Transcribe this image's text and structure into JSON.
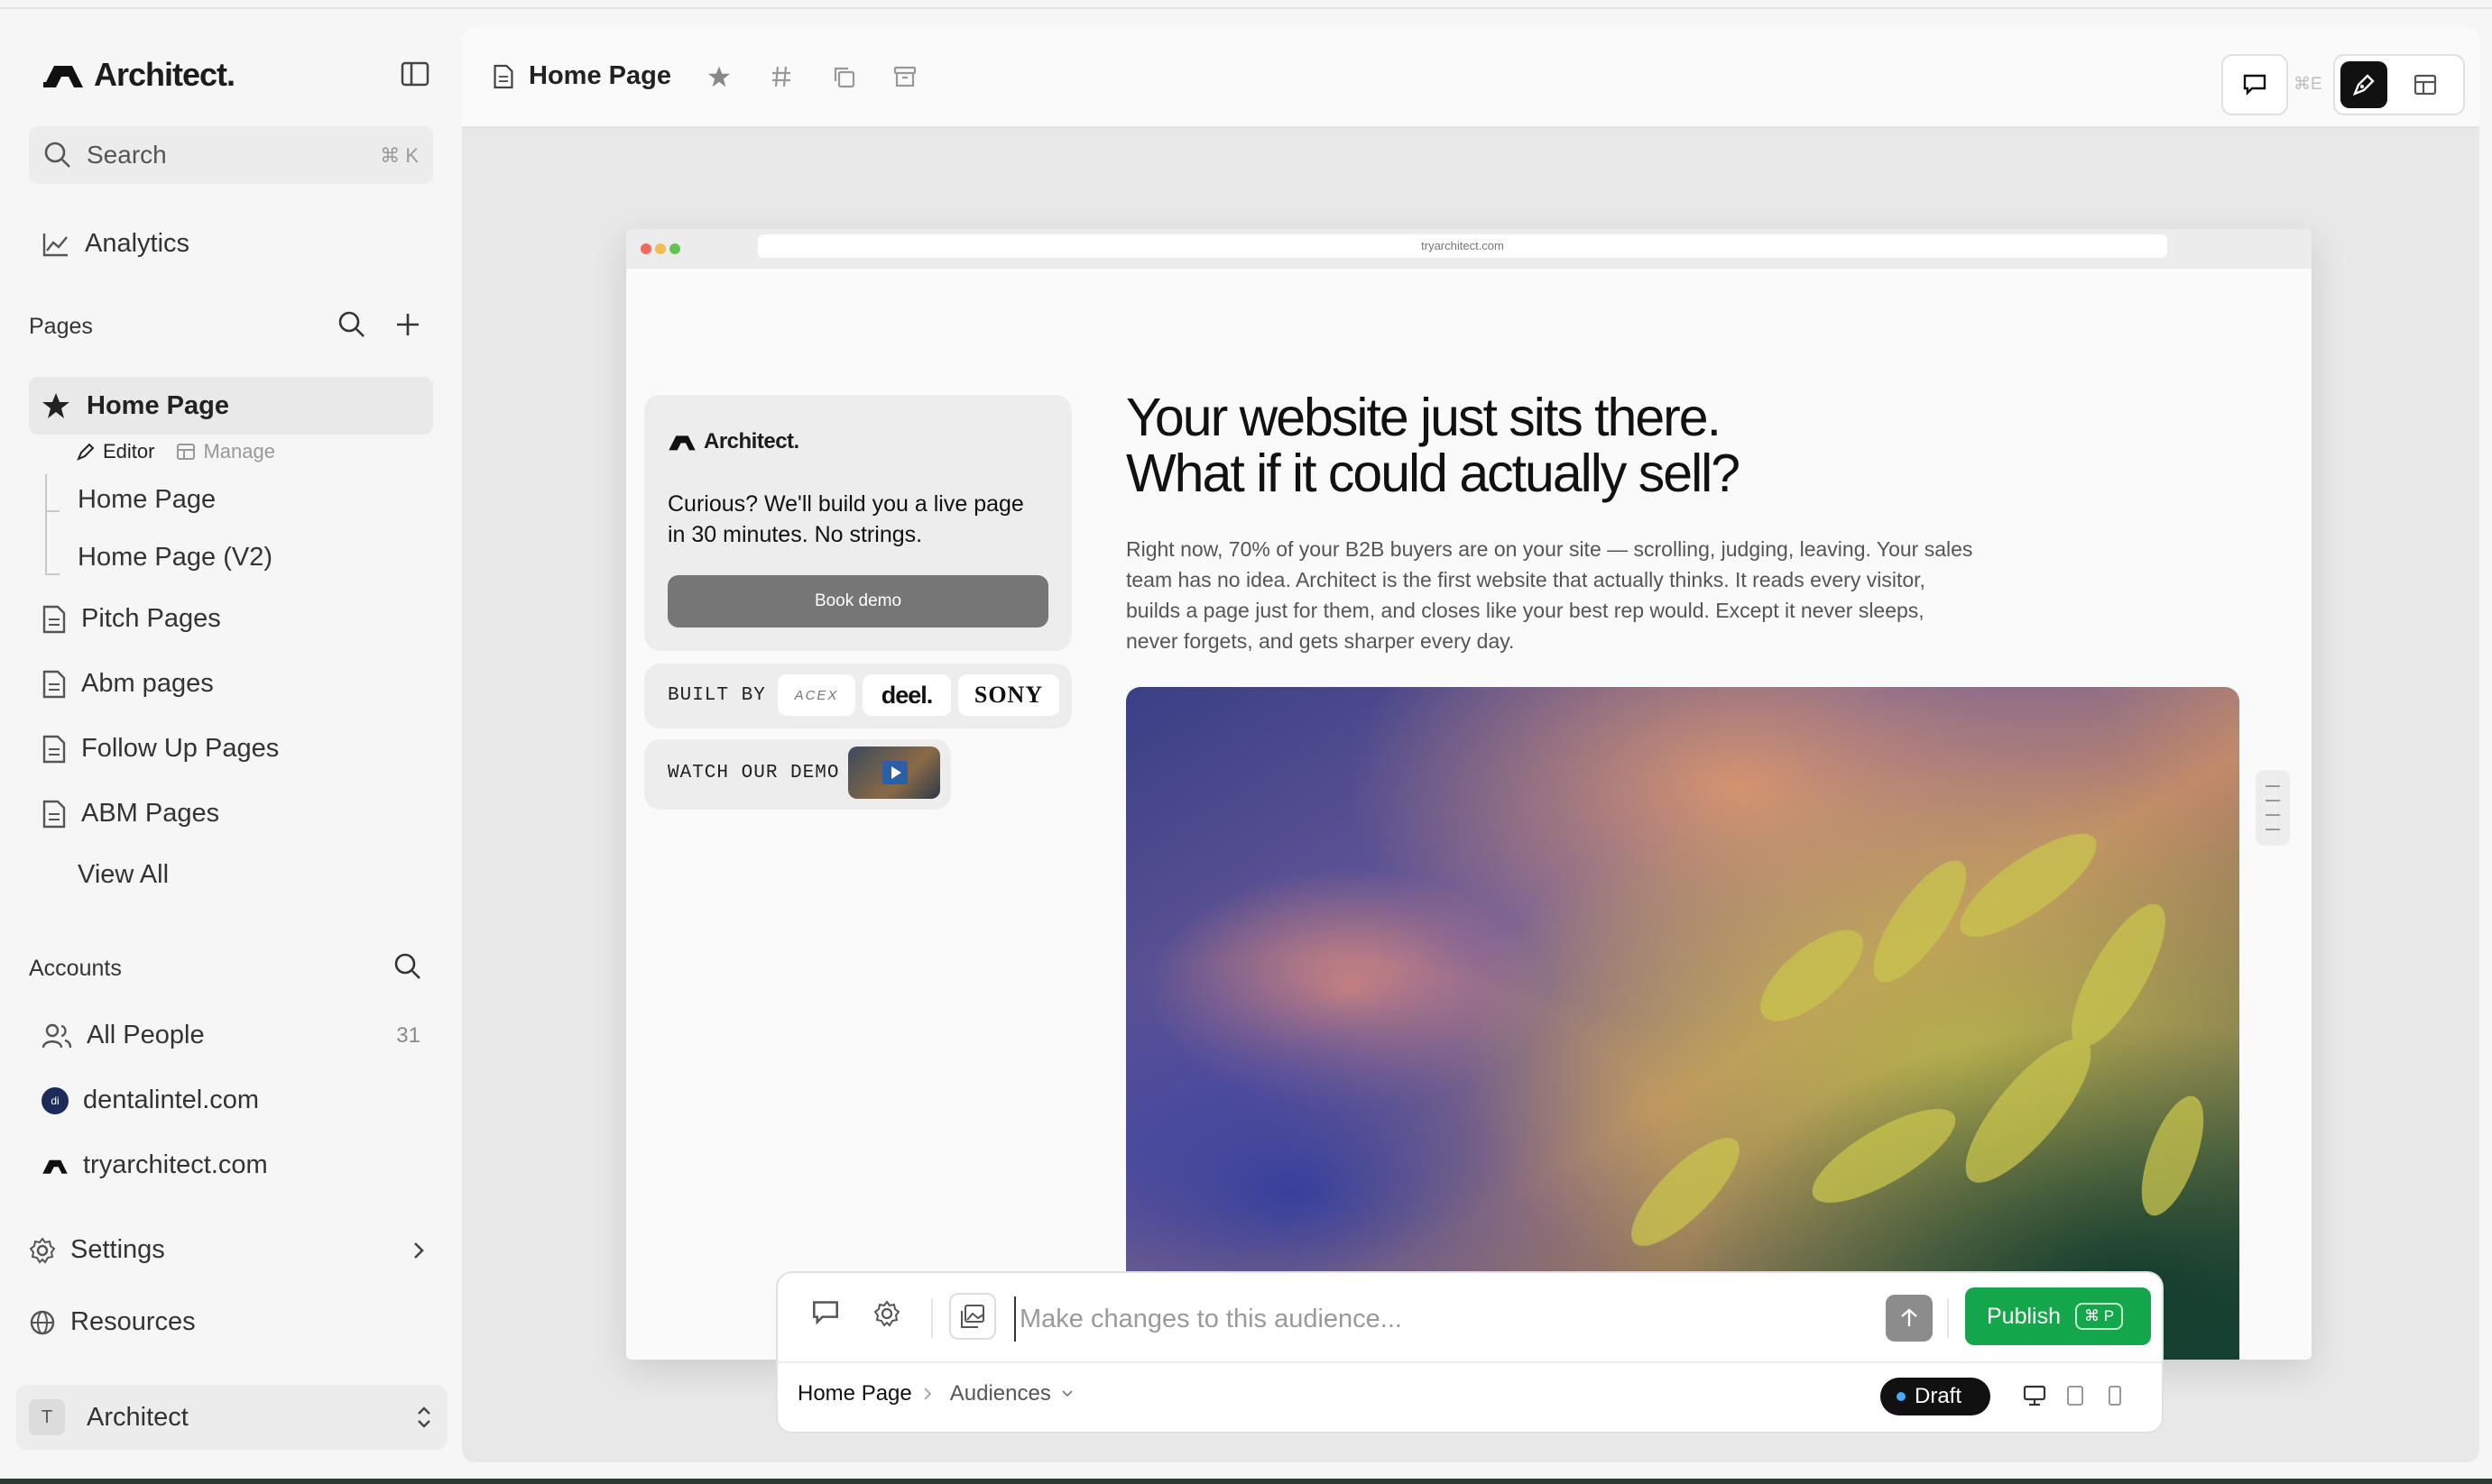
{
  "app": {
    "name": "Architect."
  },
  "sidebar": {
    "search": {
      "placeholder": "Search",
      "shortcut": "⌘ K"
    },
    "analytics_label": "Analytics",
    "pages_section": "Pages",
    "selected_page": "Home Page",
    "sub_tabs": {
      "editor": "Editor",
      "manage": "Manage"
    },
    "variants": [
      "Home Page",
      "Home Page (V2)"
    ],
    "page_groups": [
      "Pitch Pages",
      "Abm pages",
      "Follow Up Pages",
      "ABM Pages"
    ],
    "view_all": "View All",
    "accounts_section": "Accounts",
    "accounts": [
      {
        "label": "All People",
        "count": "31",
        "icon": "people-icon"
      },
      {
        "label": "dentalintel.com",
        "icon": "dentalintel-logo"
      },
      {
        "label": "tryarchitect.com",
        "icon": "architect-logo"
      }
    ],
    "settings_label": "Settings",
    "resources_label": "Resources",
    "workspace": {
      "avatar": "T",
      "name": "Architect"
    }
  },
  "toolbar": {
    "title": "Home Page",
    "hidden_shortcut": "⌘E"
  },
  "preview": {
    "url": "tryarchitect.com",
    "card": {
      "logo": "Architect.",
      "text": "Curious? We'll build you a live page in 30 minutes. No strings.",
      "button": "Book demo"
    },
    "built_by": {
      "label": "BUILT BY",
      "brands": [
        "ACEX",
        "deel.",
        "SONY"
      ]
    },
    "watch_demo": "WATCH OUR DEMO",
    "headline_1": "Your website just sits there.",
    "headline_2": "What if it could actually sell?",
    "subcopy": "Right now, 70% of your B2B buyers are on your site — scrolling, judging, leaving. Your sales team has no idea. Architect is the first website that actually thinks. It reads every visitor, builds a page just for them, and closes like your best rep would. Except it never sleeps, never forgets, and gets sharper every day."
  },
  "command_bar": {
    "placeholder": "Make changes to this audience...",
    "publish_label": "Publish",
    "publish_shortcut": "⌘ P",
    "crumb_page": "Home Page",
    "crumb_audience": "Audiences",
    "status": "Draft"
  },
  "colors": {
    "publish_green": "#14a64a",
    "draft_dot": "#4aa8ff",
    "sidebar_selected": "#e9e9e9"
  }
}
